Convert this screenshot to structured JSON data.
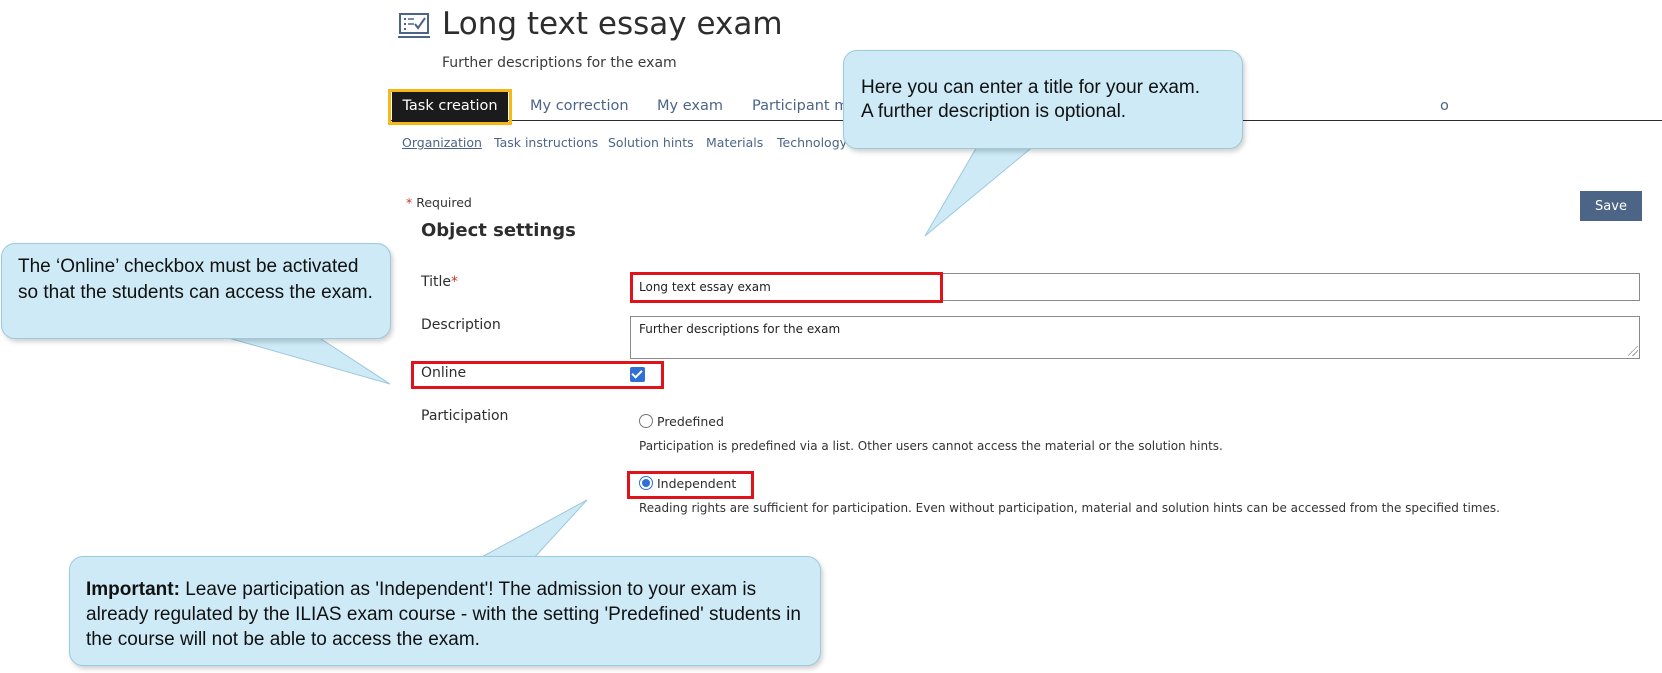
{
  "header": {
    "title": "Long text essay exam",
    "description": "Further descriptions for the exam"
  },
  "tabs": [
    {
      "label": "Task creation",
      "active": true
    },
    {
      "label": "My correction"
    },
    {
      "label": "My exam"
    },
    {
      "label": "Participant m"
    },
    {
      "label": "o"
    }
  ],
  "subtabs": [
    {
      "label": "Organization",
      "active": true
    },
    {
      "label": "Task instructions"
    },
    {
      "label": "Solution hints"
    },
    {
      "label": "Materials"
    },
    {
      "label": "Technology"
    }
  ],
  "form": {
    "required_star": "*",
    "required_label": "Required",
    "save_label": "Save",
    "section_title": "Object settings",
    "title_label": "Title",
    "title_value": "Long text essay exam",
    "description_label": "Description",
    "description_value": "Further descriptions for the exam",
    "online_label": "Online",
    "online_checked": true,
    "participation_label": "Participation",
    "participation_options": [
      {
        "label": "Predefined",
        "info": "Participation is predefined via a list. Other users cannot access the material or the solution hints.",
        "selected": false
      },
      {
        "label": "Independent",
        "info": "Reading rights are sufficient for participation. Even without participation, material and solution hints can be accessed from the specified times.",
        "selected": true
      }
    ]
  },
  "callouts": {
    "title_help_line1": "Here you can enter a title for your exam.",
    "title_help_line2": "A further description is optional.",
    "online_help": "The ‘Online’ checkbox must be activated so that the students can access the exam.",
    "participation_help_strong": "Important:",
    "participation_help_text": "Leave participation as 'Independent'! The admission to your exam is already regulated by the ILIAS exam course - with the setting 'Predefined' students in the course will not be able to access the exam."
  },
  "colors": {
    "accent": "#4c6586",
    "active_tab": "#1b1b1b",
    "tab_highlight": "#f6b817",
    "highlight_red": "#e1131a",
    "callout_bg": "#cdeaf6",
    "checkbox_blue": "#2f6fd6"
  },
  "icons": {
    "exam": "exam-checklist-icon"
  }
}
